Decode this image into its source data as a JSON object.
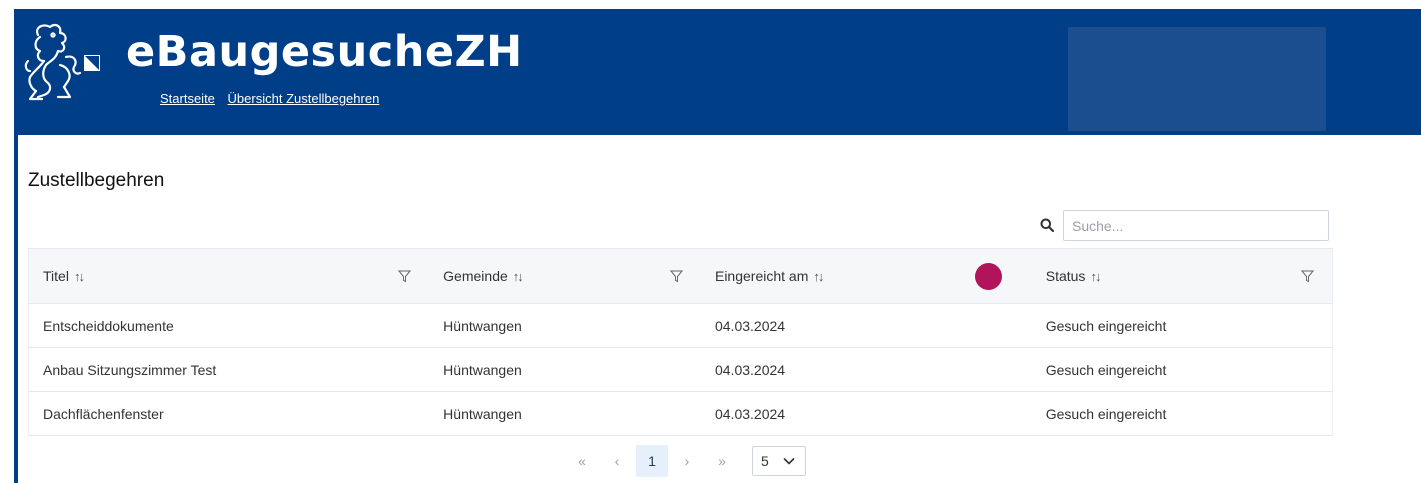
{
  "app": {
    "title": "eBaugesucheZH"
  },
  "nav": {
    "items": [
      "Startseite",
      "Übersicht Zustellbegehren"
    ]
  },
  "page": {
    "title": "Zustellbegehren"
  },
  "search": {
    "placeholder": "Suche...",
    "value": ""
  },
  "table": {
    "columns": [
      "Titel",
      "Gemeinde",
      "Eingereicht am",
      "Status"
    ],
    "rows": [
      [
        "Entscheiddokumente",
        "Hüntwangen",
        "04.03.2024",
        "Gesuch eingereicht"
      ],
      [
        "Anbau Sitzungszimmer Test",
        "Hüntwangen",
        "04.03.2024",
        "Gesuch eingereicht"
      ],
      [
        "Dachflächenfenster",
        "Hüntwangen",
        "04.03.2024",
        "Gesuch eingereicht"
      ]
    ]
  },
  "pagination": {
    "first": "«",
    "prev": "‹",
    "current_page": "1",
    "next": "›",
    "last": "»",
    "rows_per_page": "5"
  },
  "icons": {
    "logo": "zurich-lion-logo-icon",
    "search": "search-icon",
    "sort": "sort-icon",
    "filter": "filter-icon",
    "dropdown": "chevron-down-icon"
  },
  "colors": {
    "header": "#003f87",
    "accent_dot": "#b1145a",
    "active_page": "#e6f0fa"
  }
}
